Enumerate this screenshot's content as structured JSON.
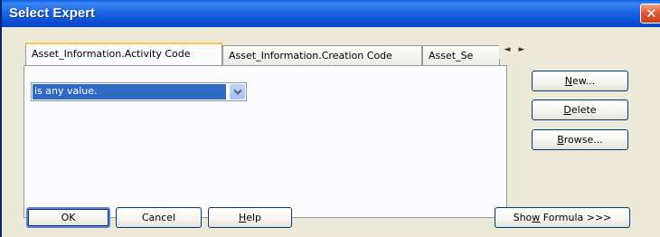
{
  "window": {
    "title": "Select Expert"
  },
  "tabs": [
    {
      "label": "Asset_Information.Activity Code",
      "active": true
    },
    {
      "label": "Asset_Information.Creation Code",
      "active": false
    },
    {
      "label": "Asset_Se",
      "active": false
    }
  ],
  "tab_scroll": {
    "left": "◄",
    "right": "►"
  },
  "condition": {
    "selected": "is any value."
  },
  "side_buttons": {
    "new_pre": "",
    "new_key": "N",
    "new_post": "ew...",
    "delete_pre": "",
    "delete_key": "D",
    "delete_post": "elete",
    "browse_pre": "",
    "browse_key": "B",
    "browse_post": "rowse..."
  },
  "bottom_buttons": {
    "ok": "OK",
    "cancel": "Cancel",
    "help_pre": "",
    "help_key": "H",
    "help_post": "elp",
    "formula_pre": "Sho",
    "formula_key": "w",
    "formula_post": " Formula >>>"
  }
}
